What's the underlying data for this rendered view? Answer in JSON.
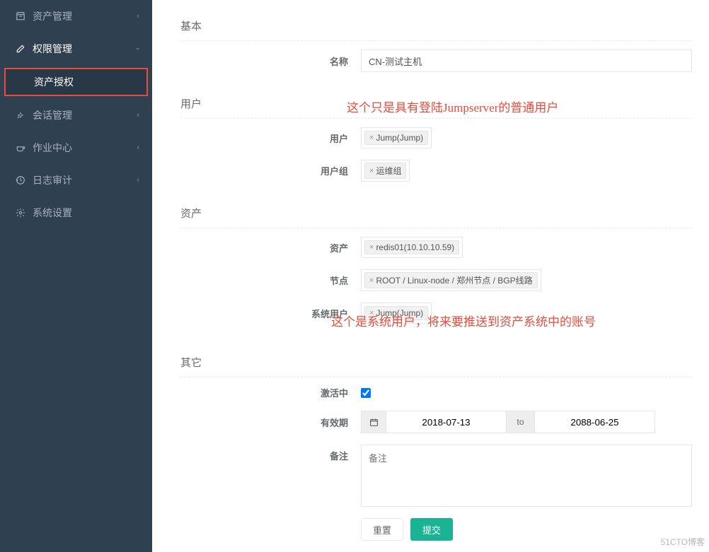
{
  "sidebar": {
    "items": [
      {
        "label": "资产管理",
        "icon": "inbox"
      },
      {
        "label": "权限管理",
        "icon": "edit"
      },
      {
        "label": "会话管理",
        "icon": "rocket"
      },
      {
        "label": "作业中心",
        "icon": "coffee"
      },
      {
        "label": "日志审计",
        "icon": "history"
      },
      {
        "label": "系统设置",
        "icon": "cogs"
      }
    ],
    "sub_item": "资产授权"
  },
  "sections": {
    "basic": "基本",
    "user": "用户",
    "asset": "资产",
    "other": "其它"
  },
  "labels": {
    "name": "名称",
    "user": "用户",
    "user_group": "用户组",
    "asset": "资产",
    "node": "节点",
    "system_user": "系统用户",
    "active": "激活中",
    "validity": "有效期",
    "remark": "备注"
  },
  "values": {
    "name": "CN-测试主机",
    "user_tag": "Jump(Jump)",
    "user_group_tag": "运维组",
    "asset_tag": "redis01(10.10.10.59)",
    "node_tag": "ROOT / Linux-node / 郑州节点 / BGP线路",
    "system_user_tag": "Jump(Jump)",
    "date_start": "2018-07-13",
    "date_to": "to",
    "date_end": "2088-06-25",
    "remark_placeholder": "备注"
  },
  "annotations": {
    "top": "这个只是具有登陆Jumpserver的普通用户",
    "bottom": "这个是系统用户，将来要推送到资产系统中的账号"
  },
  "buttons": {
    "reset": "重置",
    "submit": "提交"
  },
  "watermark": "51CTO博客"
}
